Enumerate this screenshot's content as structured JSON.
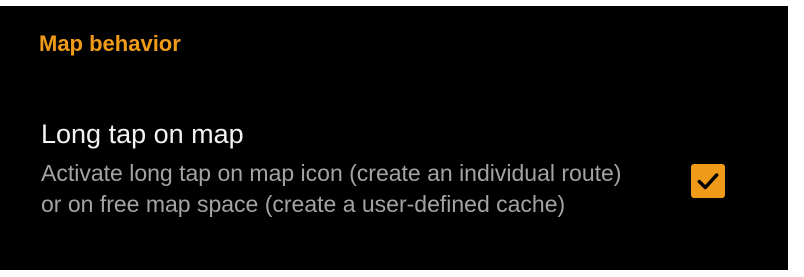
{
  "colors": {
    "background": "#000000",
    "accent": "#f09a1a",
    "title_text": "#f2f2f2",
    "summary_text": "#a3a3a3",
    "check_mark": "#000000"
  },
  "category": {
    "title": "Map behavior"
  },
  "preference": {
    "title": "Long tap on map",
    "summary": "Activate long tap on map icon (create an individual route) or on free map space (create a user-defined cache)",
    "checkbox": {
      "checked": true,
      "icon": "check-icon"
    }
  }
}
